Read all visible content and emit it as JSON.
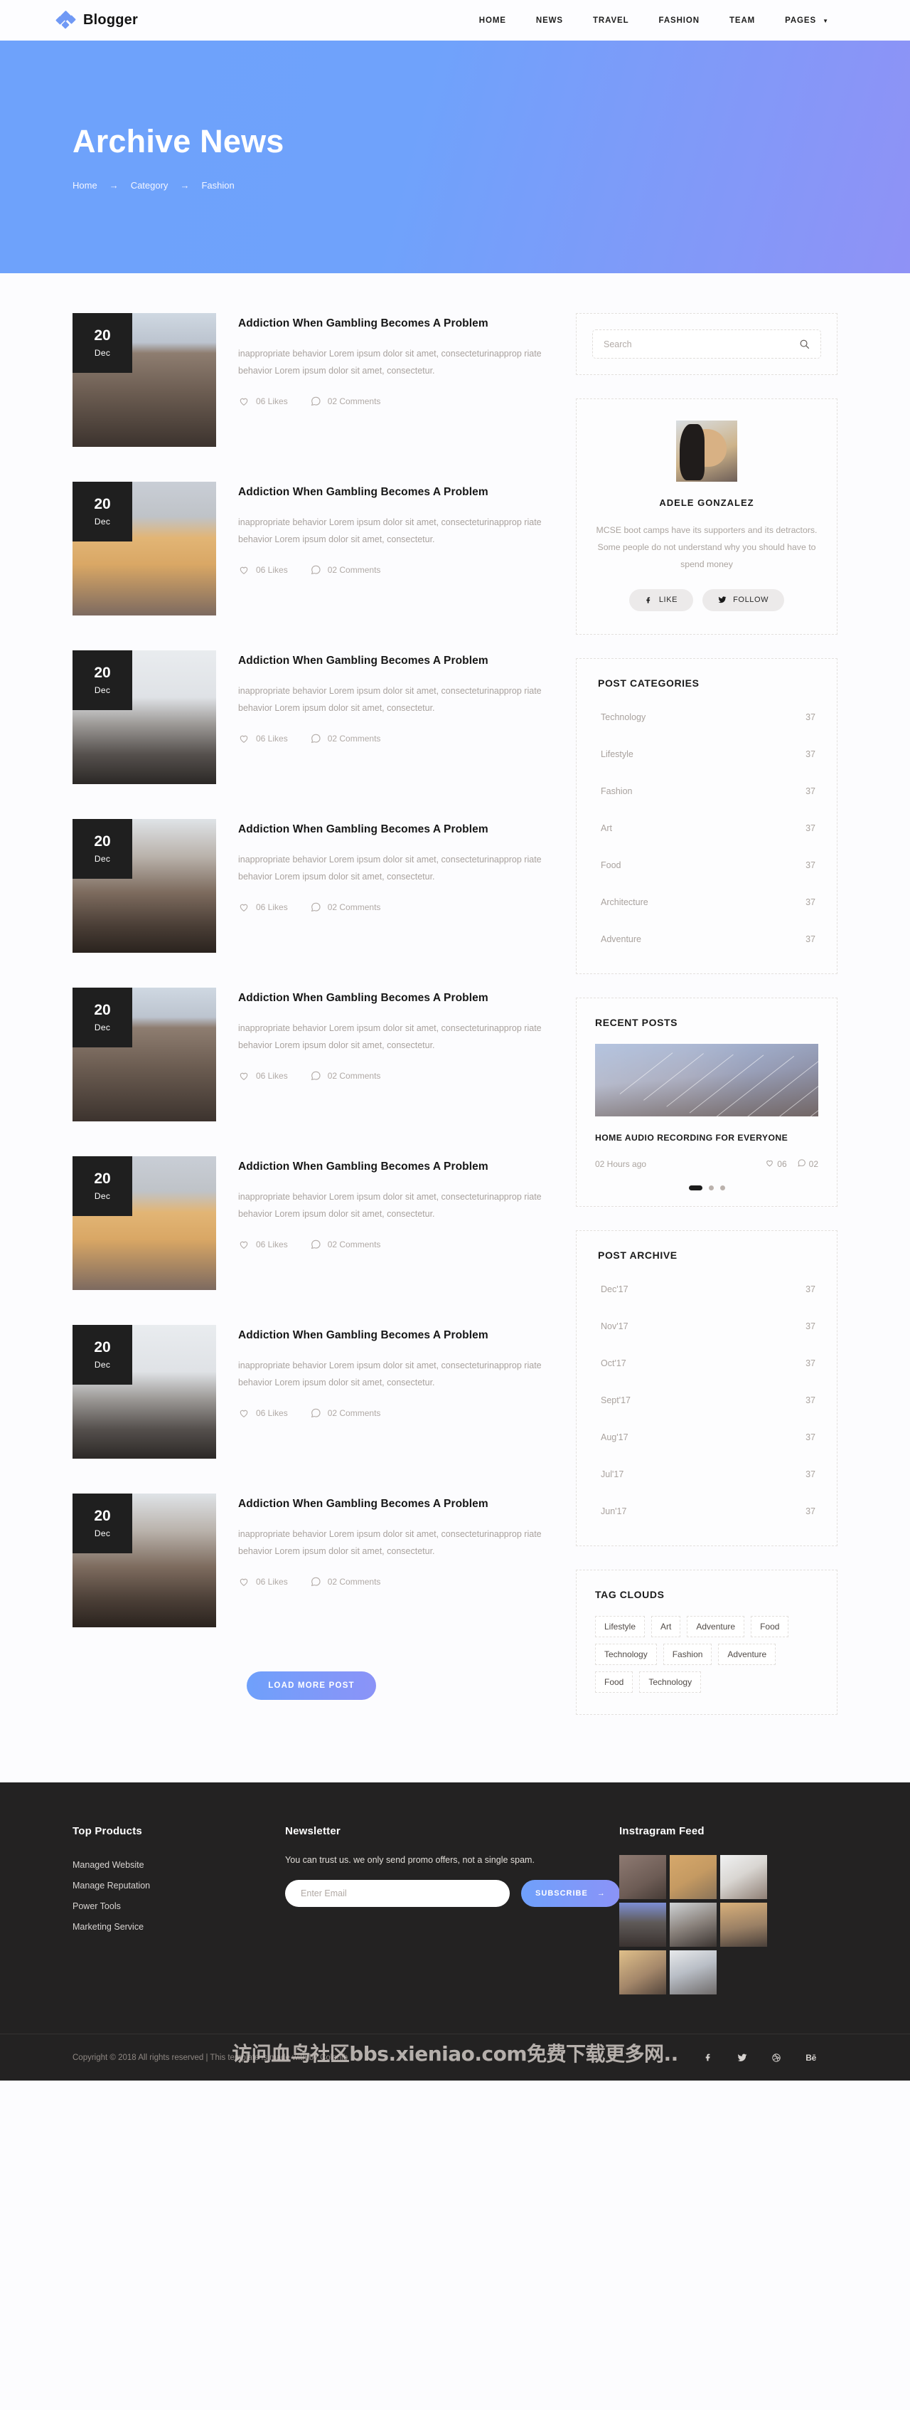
{
  "header": {
    "brand": "Blogger",
    "nav": [
      {
        "label": "HOME",
        "caret": ""
      },
      {
        "label": "NEWS",
        "caret": ""
      },
      {
        "label": "TRAVEL",
        "caret": ""
      },
      {
        "label": "FASHION",
        "caret": ""
      },
      {
        "label": "TEAM",
        "caret": ""
      },
      {
        "label": "PAGES",
        "caret": "▼"
      }
    ]
  },
  "hero": {
    "title": "Archive News",
    "breadcrumb": [
      "Home",
      "Category",
      "Fashion"
    ],
    "arrow": "→"
  },
  "posts": [
    {
      "day": "20",
      "month": "Dec",
      "title": "Addiction When Gambling Becomes A Problem",
      "desc": "inappropriate behavior Lorem ipsum dolor sit amet, consecteturinapprop riate behavior Lorem ipsum dolor sit amet, consectetur.",
      "likes": "06 Likes",
      "comments": "02 Comments",
      "image": "hikers-rocks"
    },
    {
      "day": "20",
      "month": "Dec",
      "title": "Addiction When Gambling Becomes A Problem",
      "desc": "inappropriate behavior Lorem ipsum dolor sit amet, consecteturinapprop riate behavior Lorem ipsum dolor sit amet, consectetur.",
      "likes": "06 Likes",
      "comments": "02 Comments",
      "image": "beach-sunset"
    },
    {
      "day": "20",
      "month": "Dec",
      "title": "Addiction When Gambling Becomes A Problem",
      "desc": "inappropriate behavior Lorem ipsum dolor sit amet, consecteturinapprop riate behavior Lorem ipsum dolor sit amet, consectetur.",
      "likes": "06 Likes",
      "comments": "02 Comments",
      "image": "snow-walker"
    },
    {
      "day": "20",
      "month": "Dec",
      "title": "Addiction When Gambling Becomes A Problem",
      "desc": "inappropriate behavior Lorem ipsum dolor sit amet, consecteturinapprop riate behavior Lorem ipsum dolor sit amet, consectetur.",
      "likes": "06 Likes",
      "comments": "02 Comments",
      "image": "cliff-climber"
    },
    {
      "day": "20",
      "month": "Dec",
      "title": "Addiction When Gambling Becomes A Problem",
      "desc": "inappropriate behavior Lorem ipsum dolor sit amet, consecteturinapprop riate behavior Lorem ipsum dolor sit amet, consectetur.",
      "likes": "06 Likes",
      "comments": "02 Comments",
      "image": "hikers-rocks"
    },
    {
      "day": "20",
      "month": "Dec",
      "title": "Addiction When Gambling Becomes A Problem",
      "desc": "inappropriate behavior Lorem ipsum dolor sit amet, consecteturinapprop riate behavior Lorem ipsum dolor sit amet, consectetur.",
      "likes": "06 Likes",
      "comments": "02 Comments",
      "image": "beach-sunset"
    },
    {
      "day": "20",
      "month": "Dec",
      "title": "Addiction When Gambling Becomes A Problem",
      "desc": "inappropriate behavior Lorem ipsum dolor sit amet, consecteturinapprop riate behavior Lorem ipsum dolor sit amet, consectetur.",
      "likes": "06 Likes",
      "comments": "02 Comments",
      "image": "snow-walker"
    },
    {
      "day": "20",
      "month": "Dec",
      "title": "Addiction When Gambling Becomes A Problem",
      "desc": "inappropriate behavior Lorem ipsum dolor sit amet, consecteturinapprop riate behavior Lorem ipsum dolor sit amet, consectetur.",
      "likes": "06 Likes",
      "comments": "02 Comments",
      "image": "cliff-climber"
    }
  ],
  "load_more_label": "LOAD MORE POST",
  "sidebar": {
    "search_placeholder": "Search",
    "profile": {
      "name": "ADELE GONZALEZ",
      "bio": "MCSE boot camps have its supporters and its detractors. Some people do not understand why you should have to spend money",
      "like_label": "LIKE",
      "follow_label": "FOLLOW"
    },
    "categories": {
      "title": "POST CATEGORIES",
      "items": [
        {
          "label": "Technology",
          "count": "37"
        },
        {
          "label": "Lifestyle",
          "count": "37"
        },
        {
          "label": "Fashion",
          "count": "37"
        },
        {
          "label": "Art",
          "count": "37"
        },
        {
          "label": "Food",
          "count": "37"
        },
        {
          "label": "Architecture",
          "count": "37"
        },
        {
          "label": "Adventure",
          "count": "37"
        }
      ]
    },
    "recent": {
      "title": "RECENT POSTS",
      "post_title": "HOME AUDIO RECORDING FOR EVERYONE",
      "time": "02 Hours ago",
      "likes": "06",
      "comments": "02",
      "slides": 3,
      "active_slide": 0
    },
    "archive": {
      "title": "POST ARCHIVE",
      "items": [
        {
          "label": "Dec'17",
          "count": "37"
        },
        {
          "label": "Nov'17",
          "count": "37"
        },
        {
          "label": "Oct'17",
          "count": "37"
        },
        {
          "label": "Sept'17",
          "count": "37"
        },
        {
          "label": "Aug'17",
          "count": "37"
        },
        {
          "label": "Jul'17",
          "count": "37"
        },
        {
          "label": "Jun'17",
          "count": "37"
        }
      ]
    },
    "tags": {
      "title": "TAG CLOUDS",
      "items": [
        "Lifestyle",
        "Art",
        "Adventure",
        "Food",
        "Technology",
        "Fashion",
        "Adventure",
        "Food",
        "Technology"
      ]
    }
  },
  "footer": {
    "products_title": "Top Products",
    "products": [
      "Managed Website",
      "Manage Reputation",
      "Power Tools",
      "Marketing Service"
    ],
    "newsletter_title": "Newsletter",
    "newsletter_note": "You can trust us. we only send promo offers, not a single spam.",
    "email_placeholder": "Enter Email",
    "subscribe_label": "SUBSCRIBE",
    "subscribe_arrow": "→",
    "instagram_title": "Instragram Feed",
    "instagram_cells": [
      "photo-1",
      "photo-2",
      "photo-3",
      "photo-4",
      "photo-5",
      "photo-6",
      "photo-7",
      "photo-8"
    ],
    "copyright": "Copyright © 2018 All rights reserved | This template is made with by Colorlib",
    "watermark": "访问血鸟社区bbs.xieniao.com免费下载更多网..",
    "socials": [
      "facebook",
      "twitter",
      "dribbble",
      "behance"
    ]
  },
  "colors": {
    "accent_start": "#6fa0fb",
    "accent_end": "#8b93f7",
    "dark": "#232222",
    "muted": "#a9a29e"
  }
}
